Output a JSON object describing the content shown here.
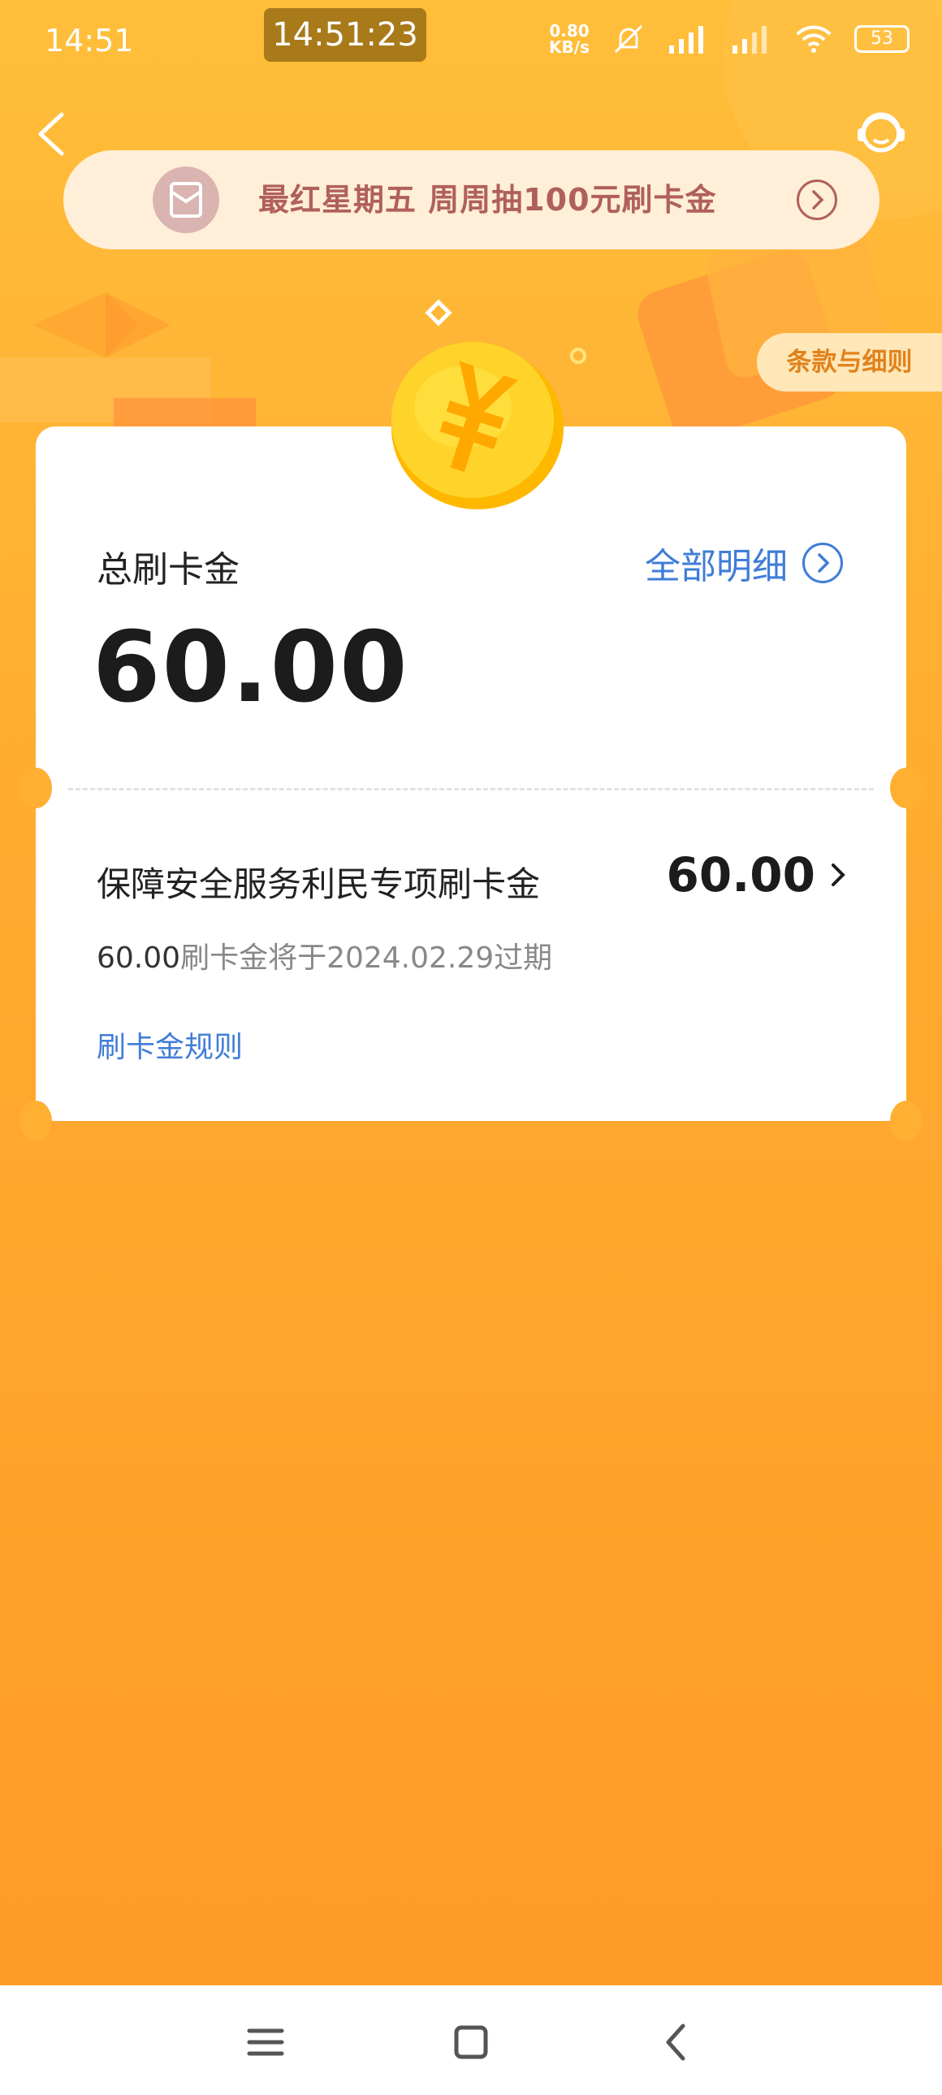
{
  "status_bar": {
    "time": "14:51",
    "timestamp_overlay": "14:51:23",
    "net_speed_top": "0.80",
    "net_speed_bottom": "KB/s",
    "battery": "53"
  },
  "promo": {
    "text": "最红星期五 周周抽100元刷卡金"
  },
  "terms_label": "条款与细则",
  "summary": {
    "label": "总刷卡金",
    "value": "60.00",
    "detail_link": "全部明细"
  },
  "item": {
    "name": "保障安全服务利民专项刷卡金",
    "amount": "60.00",
    "expiry_amount": "60.00",
    "expiry_text": "刷卡金将于2024.02.29过期",
    "rules_link": "刷卡金规则"
  },
  "icons": [
    "back-icon",
    "customer-service-icon",
    "red-envelope-icon",
    "chevron-right-icon",
    "coin-icon",
    "menu-icon",
    "home-icon",
    "nav-back-icon"
  ]
}
